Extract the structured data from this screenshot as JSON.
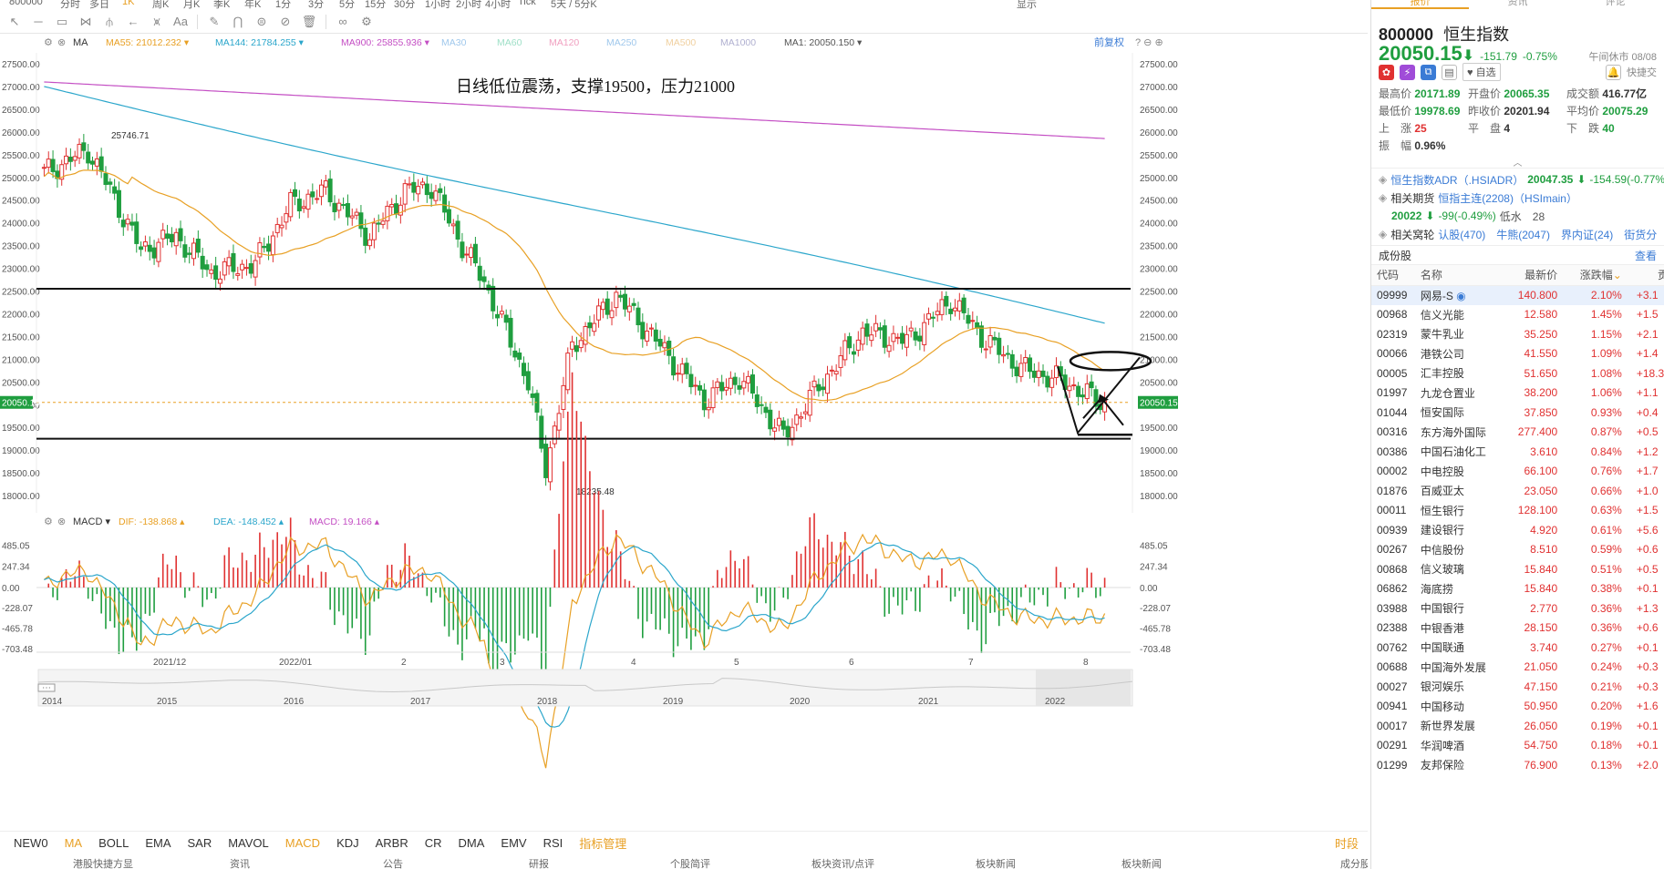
{
  "topbar": {
    "items": [
      "800000",
      "分时",
      "多日",
      "1K",
      "周K",
      "月K",
      "季K",
      "年K",
      "1分",
      "3分",
      "5分",
      "15分",
      "30分",
      "1小时",
      "2小时",
      "4小时",
      "Tick",
      "5天 / 5分K",
      "显示"
    ]
  },
  "toolbar": {
    "font_label": "Aa"
  },
  "chart": {
    "ma_label": "MA",
    "ma_items": [
      {
        "text": "MA55: 21012.232",
        "color": "#e8a024"
      },
      {
        "text": "MA144: 21784.255",
        "color": "#2ba6cb"
      },
      {
        "text": "MA900: 25855.936",
        "color": "#c44fc4"
      },
      {
        "text": "MA30",
        "color": "#a0c8ec"
      },
      {
        "text": "MA60",
        "color": "#a0e0c8"
      },
      {
        "text": "MA120",
        "color": "#f0a0c0"
      },
      {
        "text": "MA250",
        "color": "#a0c8ec"
      },
      {
        "text": "MA500",
        "color": "#f0d0a0"
      },
      {
        "text": "MA1000",
        "color": "#b0b0d0"
      },
      {
        "text": "MA1: 20050.150",
        "color": "#555555"
      }
    ],
    "adjust_label": "前复权",
    "annotation": "日线低位震荡，支撑19500，压力21000",
    "high_label": "25746.71",
    "low_label": "18235.48",
    "current_label": "20050.15",
    "y_ticks": [
      "27500.00",
      "27000.00",
      "26500.00",
      "26000.00",
      "25500.00",
      "25000.00",
      "24500.00",
      "24000.00",
      "23500.00",
      "23000.00",
      "22500.00",
      "22000.00",
      "21500.00",
      "21000.00",
      "20500.00",
      "20000.00",
      "19500.00",
      "19000.00",
      "18500.00",
      "18000.00"
    ],
    "macd_label": "MACD",
    "macd_items": [
      {
        "text": "DIF: -138.868",
        "color": "#e8a024"
      },
      {
        "text": "DEA: -148.452",
        "color": "#2ba6cb"
      },
      {
        "text": "MACD: 19.166",
        "color": "#c44fc4"
      }
    ],
    "macd_ticks": [
      "485.05",
      "247.34",
      "0.00",
      "-228.07",
      "-465.78",
      "-703.48"
    ],
    "x_labels": [
      "2021/12",
      "2022/01",
      "2",
      "3",
      "4",
      "5",
      "6",
      "7",
      "8"
    ],
    "nav_years": [
      "2014",
      "2015",
      "2016",
      "2017",
      "2018",
      "2019",
      "2020",
      "2021",
      "2022"
    ],
    "support_price": 19250,
    "resistance_price": 22550,
    "colors": {
      "up": "#e03131",
      "down": "#1f9e3f",
      "ma55": "#e8a024",
      "ma144": "#2ba6cb",
      "ma900": "#c44fc4"
    }
  },
  "bottom_tabs": [
    "NEW0",
    "MA",
    "BOLL",
    "EMA",
    "SAR",
    "MAVOL",
    "MACD",
    "KDJ",
    "ARBR",
    "CR",
    "DMA",
    "EMV",
    "RSI",
    "指标管理"
  ],
  "bottom_right": "时段",
  "footrow": [
    "港股快捷方显",
    "资讯",
    "公告",
    "研报",
    "个股简评",
    "板块资讯/点评",
    "板块新闻",
    "板块新闻",
    "成分股"
  ],
  "panel": {
    "tabs": [
      "报价",
      "资讯",
      "评论"
    ],
    "code": "800000",
    "name": "恒生指数",
    "price": "20050.15",
    "arrow": "⬇",
    "change": "-151.79",
    "change_pct": "-0.75%",
    "session": "午间休市 08/08",
    "fav_label": "自选",
    "quick_label": "快捷交",
    "stats": [
      {
        "l": "最高价",
        "v": "20171.89",
        "c": "g"
      },
      {
        "l": "开盘价",
        "v": "20065.35",
        "c": "g"
      },
      {
        "l": "成交额",
        "v": "416.77亿",
        "c": "n"
      },
      {
        "l": "最低价",
        "v": "19978.69",
        "c": "g"
      },
      {
        "l": "昨收价",
        "v": "20201.94",
        "c": "n"
      },
      {
        "l": "平均价",
        "v": "20075.29",
        "c": "g"
      },
      {
        "l": "上　涨",
        "v": "25",
        "c": "r"
      },
      {
        "l": "平　盘",
        "v": "4",
        "c": "n"
      },
      {
        "l": "下　跌",
        "v": "40",
        "c": "g"
      },
      {
        "l": "振　幅",
        "v": "0.96%",
        "c": "n"
      }
    ],
    "related": [
      {
        "label": "恒生指数ADR（.HSIADR）",
        "value": "20047.35",
        "arrow": "⬇",
        "change": "-154.59(-0.77%"
      },
      {
        "label": "相关期货",
        "value2": "恒指主连(2208)（HSImain）"
      },
      {
        "sub_value": "20022",
        "arrow": "⬇",
        "sub_change": "-99(-0.49%)",
        "extra": "低水　28"
      },
      {
        "label": "相关窝轮",
        "value2": "认股(470)　牛熊(2047)　界内证(24)　街货分"
      }
    ],
    "constituents_title": "成份股",
    "more_label": "查看",
    "columns": [
      "代码",
      "名称",
      "最新价",
      "涨跌幅",
      "贡"
    ],
    "rows": [
      [
        "09999",
        "网易-S",
        "140.800",
        "2.10%",
        "+3.1"
      ],
      [
        "00968",
        "信义光能",
        "12.580",
        "1.45%",
        "+1.5"
      ],
      [
        "02319",
        "蒙牛乳业",
        "35.250",
        "1.15%",
        "+2.1"
      ],
      [
        "00066",
        "港铁公司",
        "41.550",
        "1.09%",
        "+1.4"
      ],
      [
        "00005",
        "汇丰控股",
        "51.650",
        "1.08%",
        "+18.3"
      ],
      [
        "01997",
        "九龙仓置业",
        "38.200",
        "1.06%",
        "+1.1"
      ],
      [
        "01044",
        "恒安国际",
        "37.850",
        "0.93%",
        "+0.4"
      ],
      [
        "00316",
        "东方海外国际",
        "277.400",
        "0.87%",
        "+0.5"
      ],
      [
        "00386",
        "中国石油化工",
        "3.610",
        "0.84%",
        "+1.2"
      ],
      [
        "00002",
        "中电控股",
        "66.100",
        "0.76%",
        "+1.7"
      ],
      [
        "01876",
        "百威亚太",
        "23.050",
        "0.66%",
        "+1.0"
      ],
      [
        "00011",
        "恒生银行",
        "128.100",
        "0.63%",
        "+1.5"
      ],
      [
        "00939",
        "建设银行",
        "4.920",
        "0.61%",
        "+5.6"
      ],
      [
        "00267",
        "中信股份",
        "8.510",
        "0.59%",
        "+0.6"
      ],
      [
        "00868",
        "信义玻璃",
        "15.840",
        "0.51%",
        "+0.5"
      ],
      [
        "06862",
        "海底捞",
        "15.840",
        "0.38%",
        "+0.1"
      ],
      [
        "03988",
        "中国银行",
        "2.770",
        "0.36%",
        "+1.3"
      ],
      [
        "02388",
        "中银香港",
        "28.150",
        "0.36%",
        "+0.6"
      ],
      [
        "00762",
        "中国联通",
        "3.740",
        "0.27%",
        "+0.1"
      ],
      [
        "00688",
        "中国海外发展",
        "21.050",
        "0.24%",
        "+0.3"
      ],
      [
        "00027",
        "银河娱乐",
        "47.150",
        "0.21%",
        "+0.3"
      ],
      [
        "00941",
        "中国移动",
        "50.950",
        "0.20%",
        "+1.6"
      ],
      [
        "00017",
        "新世界发展",
        "26.050",
        "0.19%",
        "+0.1"
      ],
      [
        "00291",
        "华润啤酒",
        "54.750",
        "0.18%",
        "+0.1"
      ],
      [
        "01299",
        "友邦保险",
        "76.900",
        "0.13%",
        "+2.0"
      ]
    ]
  }
}
